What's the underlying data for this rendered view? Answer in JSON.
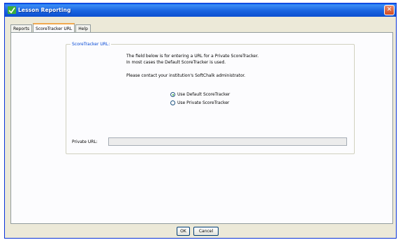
{
  "window": {
    "title": "Lesson Reporting"
  },
  "tabs": [
    {
      "label": "Reports"
    },
    {
      "label": "ScoreTracker URL"
    },
    {
      "label": "Help"
    }
  ],
  "panel": {
    "group_title": "ScoreTracker URL:",
    "lines": [
      "The field below is for entering a URL for a Private ScoreTracker.",
      "In most cases the Default ScoreTracker is used.",
      "Please contact your institution's SoftChalk administrator."
    ],
    "radio_default": {
      "label": "Use Default ScoreTracker",
      "checked": true
    },
    "radio_private": {
      "label": "Use Private ScoreTracker",
      "checked": false
    },
    "url_label": "Private URL:",
    "url_value": ""
  },
  "buttons": {
    "ok": "OK",
    "cancel": "Cancel"
  },
  "colors": {
    "titlebar": "#0b56e0",
    "legend": "#0046d5",
    "tab_highlight": "#f1a94e"
  }
}
